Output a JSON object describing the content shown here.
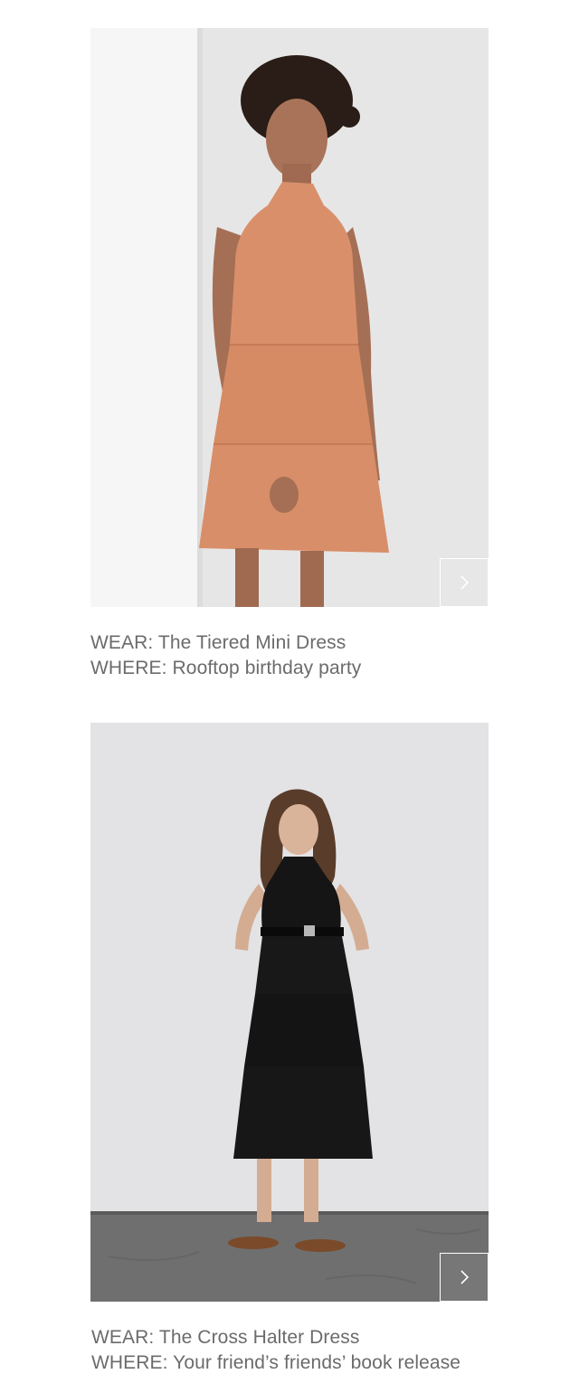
{
  "items": [
    {
      "wear": "WEAR: The Tiered Mini Dress",
      "where": "WHERE: Rooftop birthday party",
      "image_alt": "Model wearing a coral tiered mini halter dress against a white wall",
      "next_icon": "chevron-right-icon"
    },
    {
      "wear": "WEAR: The Cross Halter Dress",
      "where": "WHERE: Your friend’s friends’ book release",
      "image_alt": "Model wearing a black tiered cross halter midi dress with a belt and lace-up sandals",
      "next_icon": "chevron-right-icon"
    }
  ],
  "colors": {
    "caption_text": "#6b6b6b",
    "dress_coral": "#d9906a",
    "dress_black": "#151515",
    "wall_light": "#eeeeee",
    "floor_grey": "#6f6f6f"
  }
}
